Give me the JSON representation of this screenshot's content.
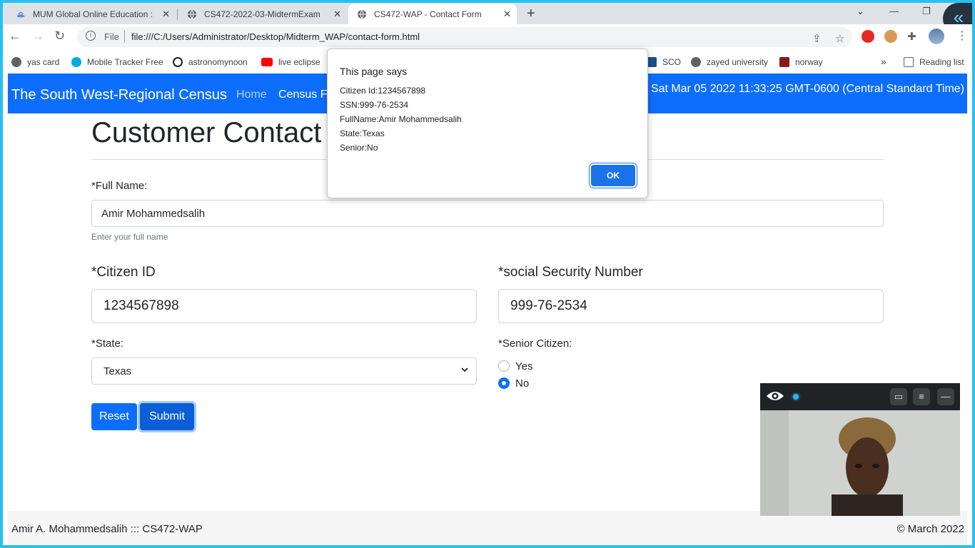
{
  "browser": {
    "tabs": [
      {
        "title": "MUM Global Online Education : C",
        "active": false
      },
      {
        "title": "CS472-2022-03-MidtermExam",
        "active": false
      },
      {
        "title": "CS472-WAP - Contact Form",
        "active": true
      }
    ],
    "omnibox": {
      "scheme_label": "File",
      "url": "file:///C:/Users/Administrator/Desktop/Midterm_WAP/contact-form.html"
    },
    "bookmarks": [
      {
        "label": "yas card",
        "color": "#5f6368"
      },
      {
        "label": "Mobile Tracker Free",
        "color": "#00a9e0"
      },
      {
        "label": "astronomynoon",
        "color": "#202124"
      },
      {
        "label": "live eclipse",
        "color": "#ff0000"
      },
      {
        "label": "SCO",
        "color": "#1f4e8c"
      },
      {
        "label": "zayed university",
        "color": "#5f6368"
      },
      {
        "label": "norway",
        "color": "#8b1a1a"
      }
    ],
    "reading_list": "Reading list",
    "more_bookmarks": "»"
  },
  "navbar": {
    "brand": "The South West-Regional Census",
    "home": "Home",
    "census": "Census Fo",
    "clock": "Sat Mar 05 2022 11:33:25 GMT-0600 (Central Standard Time)",
    "color": "#0d6efd"
  },
  "form": {
    "title": "Customer Contact",
    "full_name_label": "*Full Name:",
    "full_name_value": "Amir Mohammedsalih",
    "full_name_hint": "Enter your full name",
    "citizen_id_label": "*Citizen ID",
    "citizen_id_value": "1234567898",
    "ssn_label": "*social Security Number",
    "ssn_value": "999-76-2534",
    "state_label": "*State:",
    "state_value": "Texas",
    "senior_label": "*Senior Citizen:",
    "senior_options": [
      "Yes",
      "No"
    ],
    "senior_selected": "No",
    "reset_label": "Reset",
    "submit_label": "Submit"
  },
  "dialog": {
    "header": "This page says",
    "lines": [
      "Citizen Id:1234567898",
      "SSN:999-76-2534",
      "FullName:Amir Mohammedsalih",
      "State:Texas",
      "Senior:No"
    ],
    "ok_label": "OK"
  },
  "footer": {
    "left": "Amir A. Mohammedsalih ::: CS472-WAP",
    "right": "© March 2022"
  }
}
